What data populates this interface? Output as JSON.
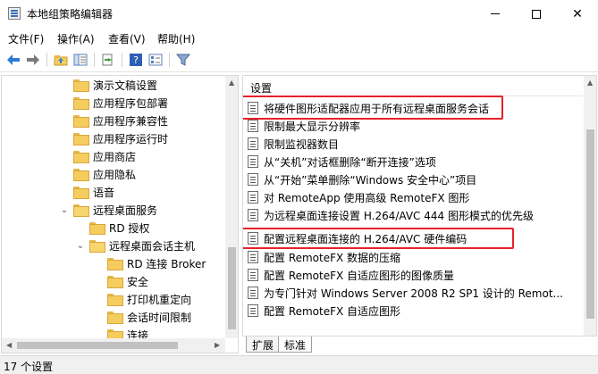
{
  "window": {
    "title": "本地组策略编辑器",
    "minimize_glyph": "",
    "close_glyph": "✕"
  },
  "menu": {
    "items": [
      "文件(F)",
      "操作(A)",
      "查看(V)",
      "帮助(H)"
    ]
  },
  "toolbar": {
    "icons": [
      "back-arrow-icon",
      "forward-arrow-icon",
      "up-folder-icon",
      "show-hide-tree-icon",
      "export-list-icon",
      "help-icon",
      "properties-icon",
      "filter-icon"
    ]
  },
  "tree": {
    "items": [
      {
        "label": "演示文稿设置"
      },
      {
        "label": "应用程序包部署"
      },
      {
        "label": "应用程序兼容性"
      },
      {
        "label": "应用程序运行时"
      },
      {
        "label": "应用商店"
      },
      {
        "label": "应用隐私"
      },
      {
        "label": "语音"
      },
      {
        "label": "远程桌面服务",
        "expander": "⌄"
      },
      {
        "label": "RD 授权"
      },
      {
        "label": "远程桌面会话主机",
        "expander": "⌄"
      },
      {
        "label": "RD 连接 Broker"
      },
      {
        "label": "安全"
      },
      {
        "label": "打印机重定向"
      },
      {
        "label": "会话时间限制"
      },
      {
        "label": "连接"
      }
    ]
  },
  "settings": {
    "header": "设置",
    "items": [
      {
        "label": "将硬件图形适配器应用于所有远程桌面服务会话",
        "highlighted": true
      },
      {
        "label": "限制最大显示分辨率"
      },
      {
        "label": "限制监视器数目"
      },
      {
        "label": "从“关机”对话框删除“断开连接”选项"
      },
      {
        "label": "从“开始”菜单删除“Windows 安全中心”项目"
      },
      {
        "label": "对 RemoteApp 使用高级 RemoteFX 图形"
      },
      {
        "label": "为远程桌面连接设置 H.264/AVC 444 图形模式的优先级"
      },
      {
        "label": "配置远程桌面连接的 H.264/AVC 硬件编码",
        "highlighted": true
      },
      {
        "label": "配置 RemoteFX 数据的压缩"
      },
      {
        "label": "配置 RemoteFX 自适应图形的图像质量"
      },
      {
        "label": "为专门针对 Windows Server 2008 R2 SP1 设计的 Remot..."
      },
      {
        "label": "配置 RemoteFX 自适应图形"
      }
    ]
  },
  "tabs": {
    "extended": "扩展",
    "standard": "标准"
  },
  "status": {
    "text": "17 个设置"
  },
  "colors": {
    "highlight": "#e8202a",
    "folder": "#f5cd5f"
  }
}
